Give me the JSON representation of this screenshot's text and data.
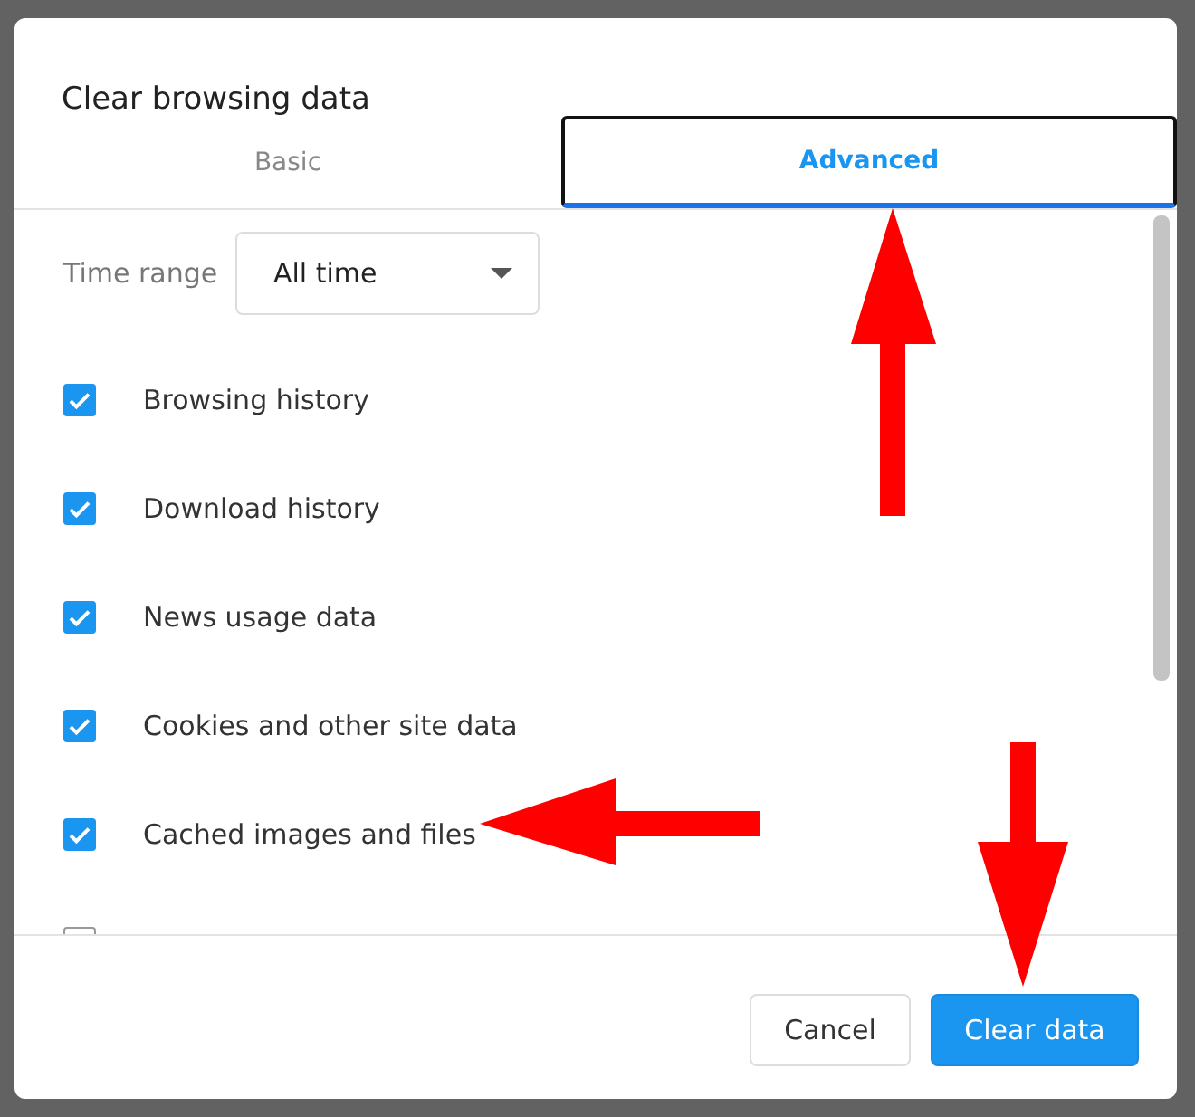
{
  "dialog": {
    "title": "Clear browsing data"
  },
  "tabs": [
    {
      "label": "Basic",
      "selected": false
    },
    {
      "label": "Advanced",
      "selected": true
    }
  ],
  "time_range": {
    "label": "Time range",
    "value": "All time"
  },
  "items": [
    {
      "label": "Browsing history",
      "checked": true
    },
    {
      "label": "Download history",
      "checked": true
    },
    {
      "label": "News usage data",
      "checked": true
    },
    {
      "label": "Cookies and other site data",
      "checked": true
    },
    {
      "label": "Cached images and files",
      "checked": true
    },
    {
      "checked": false
    }
  ],
  "buttons": [
    {
      "label": "Cancel",
      "kind": "secondary"
    },
    {
      "label": "Clear data",
      "kind": "primary"
    }
  ]
}
